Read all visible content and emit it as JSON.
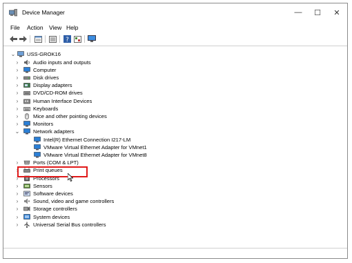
{
  "window": {
    "title": "Device Manager",
    "controls": {
      "minimize": "—",
      "maximize": "☐",
      "close": "✕"
    }
  },
  "menu": [
    "File",
    "Action",
    "View",
    "Help"
  ],
  "toolbar": {
    "buttons": [
      "back-arrow",
      "forward-arrow",
      "properties",
      "show-hidden",
      "help",
      "view-resources",
      "scan-hardware"
    ]
  },
  "tree": {
    "root": "USS-GROK16",
    "categories": [
      "Audio inputs and outputs",
      "Computer",
      "Disk drives",
      "Display adapters",
      "DVD/CD-ROM drives",
      "Human Interface Devices",
      "Keyboards",
      "Mice and other pointing devices",
      "Monitors",
      "Network adapters",
      "Ports (COM & LPT)",
      "Print queues",
      "Processors",
      "Sensors",
      "Software devices",
      "Sound, video and game controllers",
      "Storage controllers",
      "System devices",
      "Universal Serial Bus controllers"
    ],
    "network_children": [
      "Intel(R) Ethernet Connection I217-LM",
      "VMware Virtual Ethernet Adapter for VMnet1",
      "VMware Virtual Ethernet Adapter for VMnet8"
    ]
  },
  "colors": {
    "highlight_box": "#e01818",
    "icon_blue": "#2b7fd6"
  }
}
